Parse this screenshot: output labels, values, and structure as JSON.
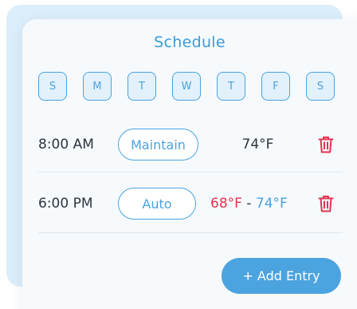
{
  "schedule": {
    "title": "Schedule",
    "days": [
      "S",
      "M",
      "T",
      "W",
      "T",
      "F",
      "S"
    ],
    "entries": [
      {
        "time": "8:00 AM",
        "mode": "Maintain",
        "temperature": "74°F"
      },
      {
        "time": "6:00 PM",
        "mode": "Auto",
        "temp_low": "68°F",
        "separator": " - ",
        "temp_high": "74°F"
      }
    ],
    "add_entry_label": "+ Add Entry"
  },
  "colors": {
    "accent": "#4ba3df",
    "danger": "#e5324f",
    "text": "#2f3440",
    "card_bg": "#f6fafd",
    "back_card_bg": "#dceefb"
  },
  "icons": {
    "delete": "trash-icon"
  }
}
